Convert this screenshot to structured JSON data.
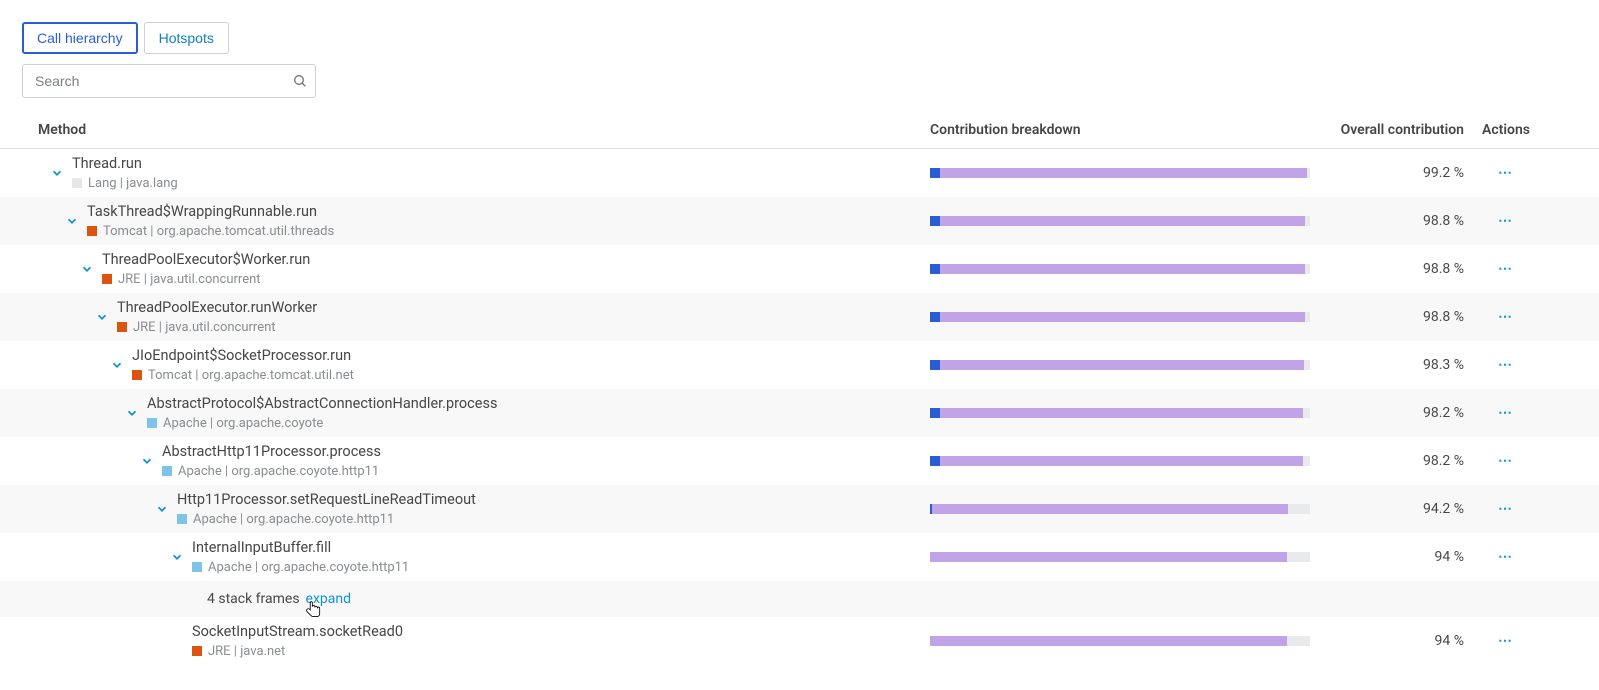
{
  "tabs": {
    "call_hierarchy": "Call hierarchy",
    "hotspots": "Hotspots"
  },
  "search": {
    "placeholder": "Search"
  },
  "headers": {
    "method": "Method",
    "breakdown": "Contribution breakdown",
    "overall": "Overall contribution",
    "actions": "Actions"
  },
  "rows": [
    {
      "indent": 0,
      "name": "Thread.run",
      "lib": "Lang",
      "pkg": "java.lang",
      "swatch": "swatch-lang",
      "blue": 2.5,
      "purple": 96.7,
      "overall": "99.2 %",
      "alt": false
    },
    {
      "indent": 1,
      "name": "TaskThread$WrappingRunnable.run",
      "lib": "Tomcat",
      "pkg": "org.apache.tomcat.util.threads",
      "swatch": "swatch-tomcat",
      "blue": 2.5,
      "purple": 96.3,
      "overall": "98.8 %",
      "alt": true
    },
    {
      "indent": 2,
      "name": "ThreadPoolExecutor$Worker.run",
      "lib": "JRE",
      "pkg": "java.util.concurrent",
      "swatch": "swatch-jre",
      "blue": 2.5,
      "purple": 96.3,
      "overall": "98.8 %",
      "alt": false
    },
    {
      "indent": 3,
      "name": "ThreadPoolExecutor.runWorker",
      "lib": "JRE",
      "pkg": "java.util.concurrent",
      "swatch": "swatch-jre",
      "blue": 2.5,
      "purple": 96.3,
      "overall": "98.8 %",
      "alt": true
    },
    {
      "indent": 4,
      "name": "JIoEndpoint$SocketProcessor.run",
      "lib": "Tomcat",
      "pkg": "org.apache.tomcat.util.net",
      "swatch": "swatch-tomcat",
      "blue": 2.5,
      "purple": 95.8,
      "overall": "98.3 %",
      "alt": false
    },
    {
      "indent": 5,
      "name": "AbstractProtocol$AbstractConnectionHandler.process",
      "lib": "Apache",
      "pkg": "org.apache.coyote",
      "swatch": "swatch-apache",
      "blue": 2.5,
      "purple": 95.7,
      "overall": "98.2 %",
      "alt": true
    },
    {
      "indent": 6,
      "name": "AbstractHttp11Processor.process",
      "lib": "Apache",
      "pkg": "org.apache.coyote.http11",
      "swatch": "swatch-apache",
      "blue": 2.5,
      "purple": 95.7,
      "overall": "98.2 %",
      "alt": false
    },
    {
      "indent": 7,
      "name": "Http11Processor.setRequestLineReadTimeout",
      "lib": "Apache",
      "pkg": "org.apache.coyote.http11",
      "swatch": "swatch-apache",
      "blue": 0.6,
      "purple": 93.6,
      "overall": "94.2 %",
      "alt": true
    },
    {
      "indent": 8,
      "name": "InternalInputBuffer.fill",
      "lib": "Apache",
      "pkg": "org.apache.coyote.http11",
      "swatch": "swatch-apache",
      "blue": 0,
      "purple": 94.0,
      "overall": "94 %",
      "alt": false
    }
  ],
  "frames": {
    "text": "4 stack frames",
    "link": "expand",
    "indent": 9
  },
  "last_row": {
    "indent": 10,
    "name": "SocketInputStream.socketRead0",
    "lib": "JRE",
    "pkg": "java.net",
    "swatch": "swatch-jre",
    "blue": 0,
    "purple": 94.0,
    "overall": "94 %",
    "alt": false
  }
}
